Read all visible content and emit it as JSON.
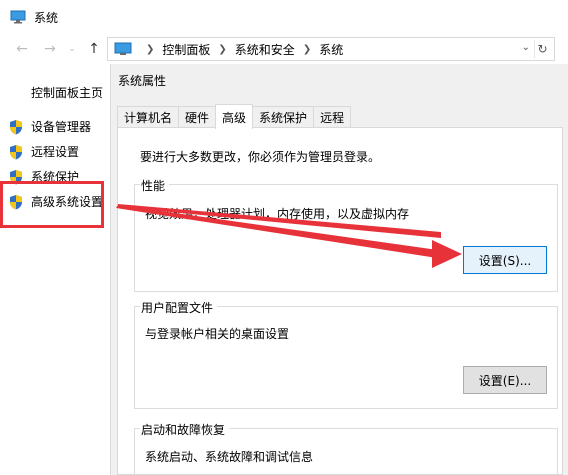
{
  "window": {
    "title": "系统",
    "icon": "computer-icon"
  },
  "nav": {
    "back_icon": "←",
    "forward_icon": "→",
    "dropdown_icon": "⌄",
    "up_icon": "↑"
  },
  "address": {
    "crumbs": [
      "控制面板",
      "系统和安全",
      "系统"
    ],
    "refresh_icon": "↻",
    "dropdown_icon": "⌄"
  },
  "left_pane": {
    "home_link": "控制面板主页",
    "items": [
      {
        "label": "设备管理器",
        "icon": "uac-shield-icon"
      },
      {
        "label": "远程设置",
        "icon": "uac-shield-icon"
      },
      {
        "label": "系统保护",
        "icon": "uac-shield-icon"
      },
      {
        "label": "高级系统设置",
        "icon": "uac-shield-icon"
      }
    ]
  },
  "dialog": {
    "title": "系统属性",
    "tabs": [
      {
        "label": "计算机名",
        "active": false
      },
      {
        "label": "硬件",
        "active": false
      },
      {
        "label": "高级",
        "active": true
      },
      {
        "label": "系统保护",
        "active": false
      },
      {
        "label": "远程",
        "active": false
      }
    ],
    "admin_note": "要进行大多数更改，你必须作为管理员登录。",
    "performance": {
      "title": "性能",
      "desc": "视觉效果，处理器计划，内存使用，以及虚拟内存",
      "button": "设置(S)..."
    },
    "user_profiles": {
      "title": "用户配置文件",
      "desc": "与登录帐户相关的桌面设置",
      "button": "设置(E)..."
    },
    "startup_recovery": {
      "title": "启动和故障恢复",
      "desc": "系统启动、系统故障和调试信息"
    }
  },
  "colors": {
    "annotation_red": "#e8323a",
    "focus_blue": "#0078d7"
  }
}
